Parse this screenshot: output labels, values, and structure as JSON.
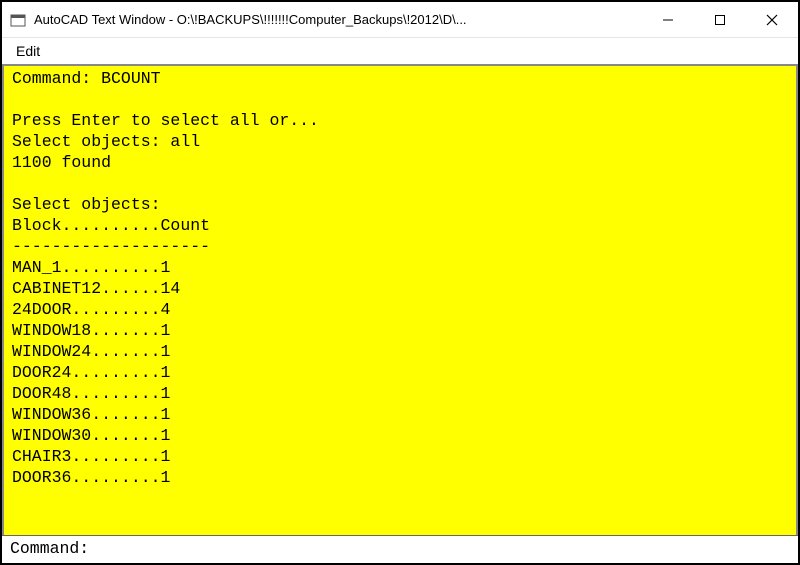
{
  "titlebar": {
    "title": "AutoCAD Text Window - O:\\!BACKUPS\\!!!!!!!Computer_Backups\\!2012\\D\\..."
  },
  "menubar": {
    "edit": "Edit"
  },
  "terminal": {
    "lines": [
      "Command: BCOUNT",
      "",
      "Press Enter to select all or...",
      "Select objects: all",
      "1100 found",
      "",
      "Select objects:",
      "Block..........Count",
      "--------------------",
      "MAN_1..........1",
      "CABINET12......14",
      "24DOOR.........4",
      "WINDOW18.......1",
      "WINDOW24.......1",
      "DOOR24.........1",
      "DOOR48.........1",
      "WINDOW36.......1",
      "WINDOW30.......1",
      "CHAIR3.........1",
      "DOOR36.........1"
    ]
  },
  "cmdline": {
    "prompt": "Command: ",
    "value": ""
  }
}
